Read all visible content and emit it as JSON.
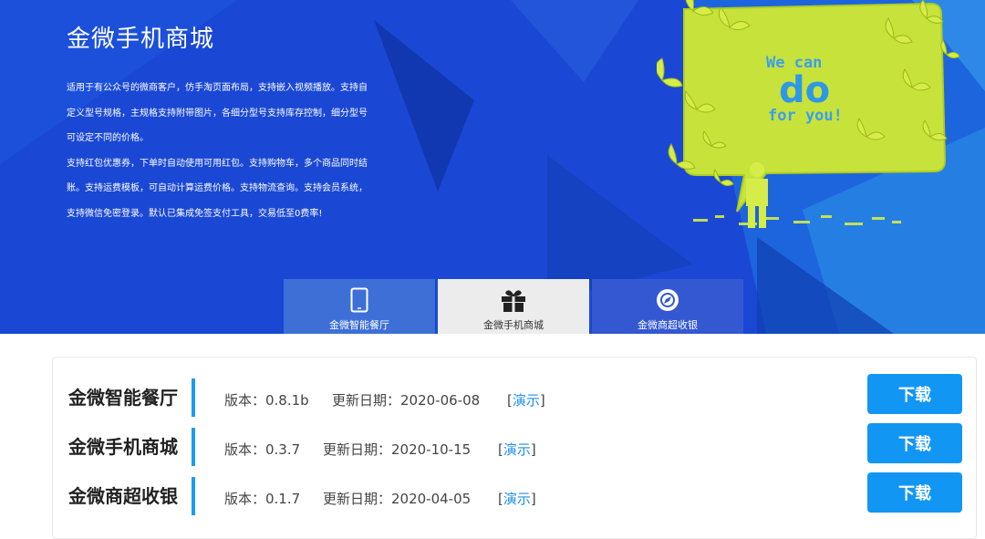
{
  "hero": {
    "title": "金微手机商城",
    "desc": [
      "适用于有公众号的微商客户，仿手淘页面布局，支持嵌入视频播放。支持自",
      "定义型号规格，主规格支持附带图片，各细分型号支持库存控制，细分型号",
      "可设定不同的价格。",
      "支持红包优惠券，下单时自动使用可用红包。支持购物车，多个商品同时结",
      "账。支持运费模板，可自动计算运费价格。支持物流查询。支持会员系统，",
      "支持微信免密登录。默认已集成免签支付工具，交易低至0费率!"
    ],
    "art": {
      "line1": "We can",
      "line2": "do",
      "line3": "for you!"
    }
  },
  "tabs": [
    {
      "label": "金微智能餐厅",
      "icon": "phone-icon",
      "color": "#3d6fd6"
    },
    {
      "label": "金微手机商城",
      "icon": "gift-icon",
      "color": "#ececec",
      "active": true
    },
    {
      "label": "金微商超收银",
      "icon": "compass-icon",
      "color": "#3458d2"
    }
  ],
  "products": [
    {
      "name": "金微智能餐厅",
      "version": "版本：0.8.1b",
      "date": "更新日期：2020-06-08",
      "demo_open": "[",
      "demo": "演示",
      "demo_close": "]",
      "download": "下载"
    },
    {
      "name": "金微手机商城",
      "version": "版本：0.3.7",
      "date": "更新日期：2020-10-15",
      "demo_open": "[",
      "demo": "演示",
      "demo_close": "]",
      "download": "下载"
    },
    {
      "name": "金微商超收银",
      "version": "版本：0.1.7",
      "date": "更新日期：2020-04-05",
      "demo_open": "[",
      "demo": "演示",
      "demo_close": "]",
      "download": "下载"
    }
  ],
  "colors": {
    "hero_bg": "#1a48d4",
    "accent": "#1296f3",
    "link": "#1e8ef0",
    "bubble": "#c8e23c"
  }
}
